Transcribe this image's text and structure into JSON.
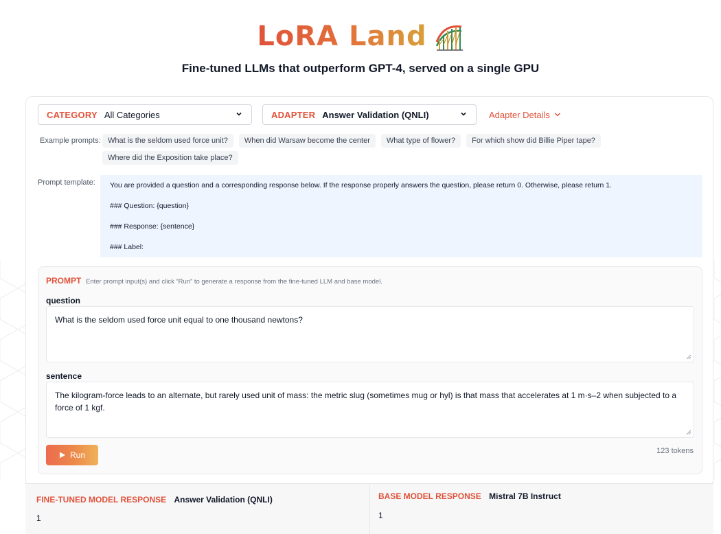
{
  "header": {
    "logo_text": "LoRA Land",
    "subtitle": "Fine-tuned LLMs that outperform GPT-4, served on a single GPU"
  },
  "selectors": {
    "category_label": "CATEGORY",
    "category_value": "All Categories",
    "adapter_label": "ADAPTER",
    "adapter_value": "Answer Validation (QNLI)",
    "adapter_details": "Adapter Details"
  },
  "examples": {
    "label": "Example prompts:",
    "chips": [
      "What is the seldom used force unit?",
      "When did Warsaw become the center",
      "What type of flower?",
      "For which show did Billie Piper tape?",
      "Where did the Exposition take place?"
    ]
  },
  "template": {
    "label": "Prompt template:",
    "lines": [
      "You are provided a question and a corresponding response below. If the response properly answers the question, please return 0. Otherwise, please return 1.",
      "### Question: {question}",
      "### Response: {sentence}",
      "### Label:"
    ]
  },
  "prompt": {
    "label": "PROMPT",
    "hint": "Enter prompt input(s) and click “Run” to generate a response from the fine-tuned LLM and base model.",
    "fields": [
      {
        "label": "question",
        "value": "What is the seldom used force unit equal to one thousand newtons?"
      },
      {
        "label": "sentence",
        "value": "The kilogram-force leads to an alternate, but rarely used unit of mass: the metric slug (sometimes mug or hyl) is that mass that accelerates at 1 m·s–2 when subjected to a force of 1 kgf."
      }
    ],
    "run_label": "Run",
    "tokens": "123 tokens"
  },
  "responses": {
    "finetuned_label": "FINE-TUNED MODEL RESPONSE",
    "finetuned_model": "Answer Validation (QNLI)",
    "finetuned_value": "1",
    "base_label": "BASE MODEL RESPONSE",
    "base_model": "Mistral 7B Instruct",
    "base_value": "1"
  },
  "colors": {
    "accent": "#e0523a",
    "template_bg": "#eff5ff",
    "chip_bg": "#f3f4f6"
  },
  "icons": {
    "logo": "roller-coaster-icon",
    "dropdown": "chevron-down-icon",
    "run": "play-icon"
  }
}
